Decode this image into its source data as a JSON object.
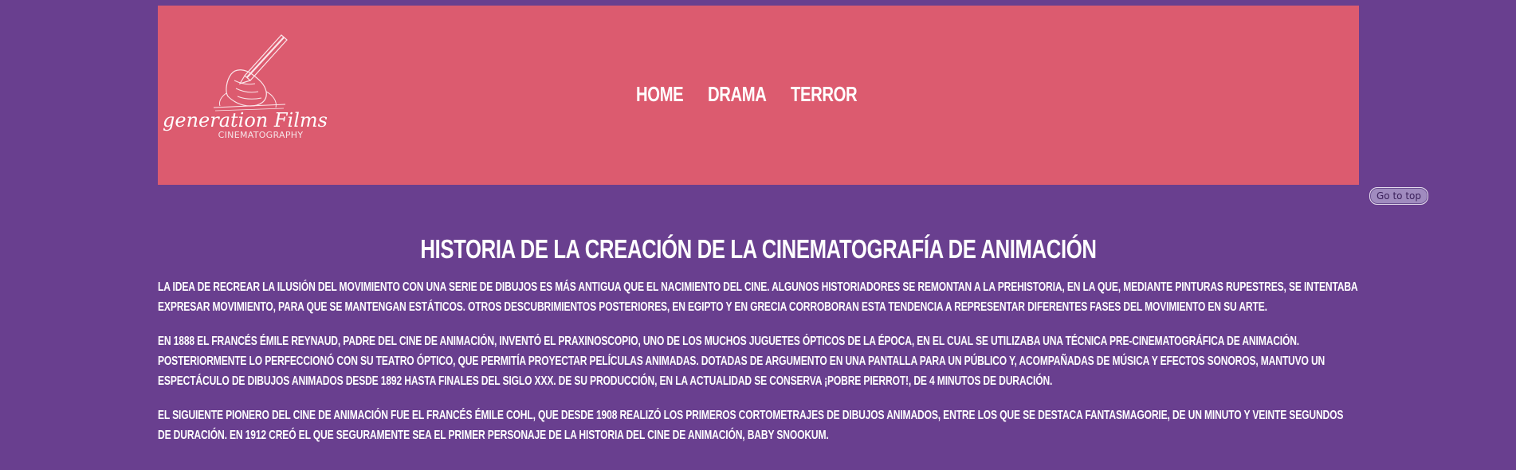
{
  "header": {
    "logo_script": "generation Films",
    "logo_sub": "CINEMATOGRAPHY",
    "nav": [
      {
        "label": "Home"
      },
      {
        "label": "Drama"
      },
      {
        "label": "Terror"
      }
    ],
    "bg_color": "#dc5b6f"
  },
  "page_bg": "#693f8f",
  "go_to_top_label": "Go to top",
  "main": {
    "title": "Historia de la creación de la cinematografía de animación",
    "paragraphs": [
      "La idea de recrear la ilusión del movimiento con una serie de dibujos es más antigua que el nacimiento del cine. Algunos historiadores se remontan a la prehistoria, en la que, mediante pinturas rupestres, se intentaba expresar movimiento, para que se mantengan estáticos. Otros descubrimientos posteriores, en Egipto y en Grecia corroboran esta tendencia a representar diferentes fases del movimiento en su arte.",
      "En 1888 el francés Émile Reynaud, padre del cine de animación, inventó el praxinoscopio, uno de los muchos juguetes ópticos de la época, en el cual se utilizaba una técnica pre-cinematográfica de animación. Posteriormente lo perfeccionó con su teatro óptico, que permitía proyectar películas animadas. Dotadas de argumento en una pantalla para un público y, acompañadas de música y efectos sonoros, mantuvo un espectáculo de dibujos animados desde 1892 hasta finales del siglo XXX. De su producción, en la actualidad se conserva ¡Pobre Pierrot!, de 4 minutos de duración.",
      "El siguiente pionero del cine de animación fue el francés Émile Cohl, que desde 1908 realizó los primeros cortometrajes de dibujos animados, entre los que se destaca Fantasmagorie, de un minuto y veinte segundos de duración. En 1912 creó el que seguramente sea el primer personaje de la historia del cine de animación, Baby Snookum."
    ]
  }
}
